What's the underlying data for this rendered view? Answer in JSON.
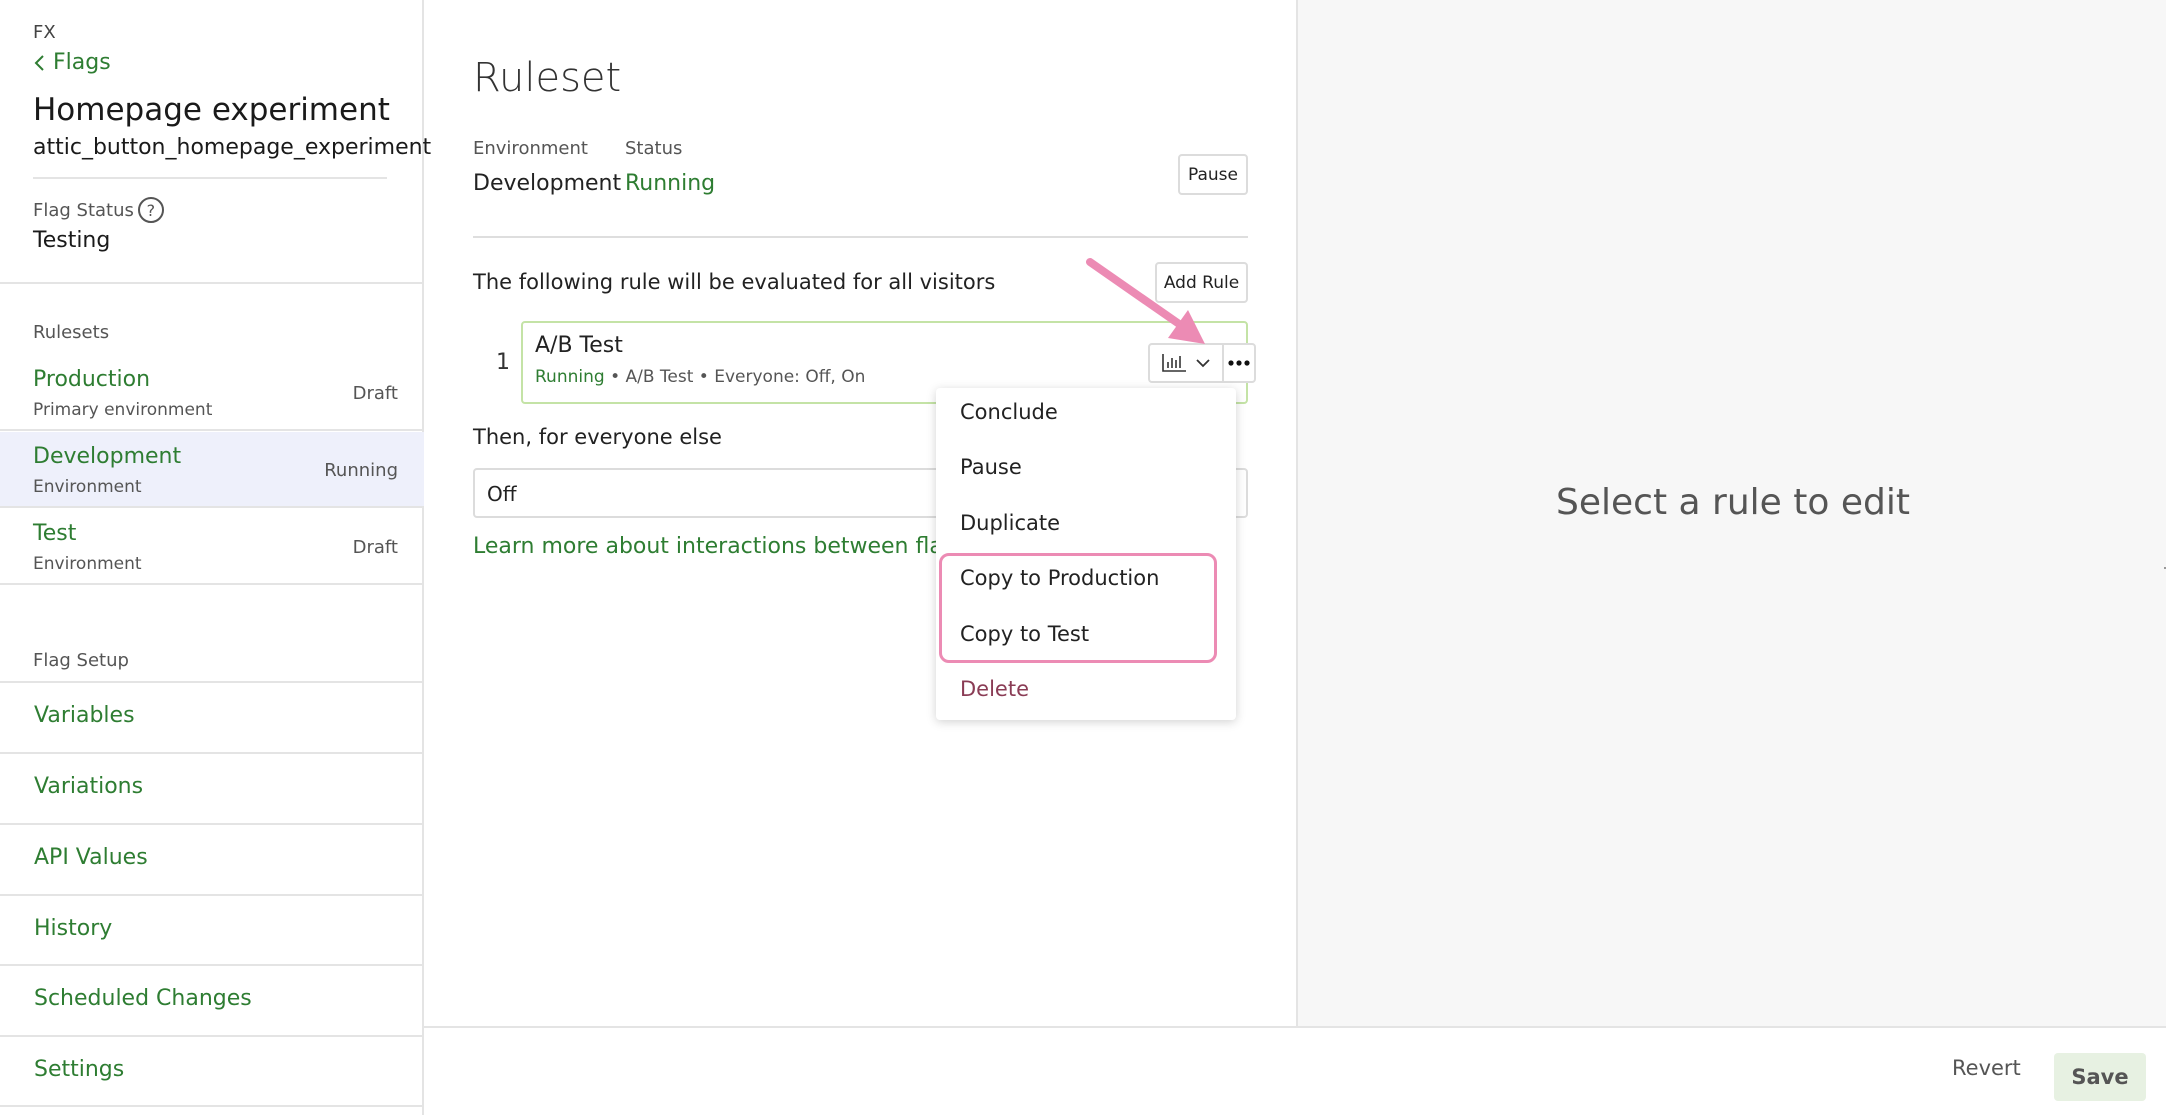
{
  "sidebar": {
    "brand": "FX",
    "back_label": "Flags",
    "flag_title": "Homepage experiment",
    "flag_key": "attic_button_homepage_experiment",
    "flag_status_label": "Flag Status",
    "flag_status_value": "Testing",
    "rulesets_label": "Rulesets",
    "rulesets": [
      {
        "name": "Production",
        "sub": "Primary environment",
        "state": "Draft"
      },
      {
        "name": "Development",
        "sub": "Environment",
        "state": "Running"
      },
      {
        "name": "Test",
        "sub": "Environment",
        "state": "Draft"
      }
    ],
    "setup_label": "Flag Setup",
    "setup_items": [
      "Variables",
      "Variations",
      "API Values",
      "History",
      "Scheduled Changes",
      "Settings"
    ]
  },
  "main": {
    "title": "Ruleset",
    "environment_label": "Environment",
    "environment_value": "Development",
    "status_label": "Status",
    "status_value": "Running",
    "pause_button": "Pause",
    "rule_intro": "The following rule will be evaluated for all visitors",
    "add_rule_button": "Add Rule",
    "rule": {
      "index": "1",
      "name": "A/B Test",
      "status": "Running",
      "details": " • A/B Test • Everyone: Off, On"
    },
    "else_label": "Then, for everyone else",
    "else_value": "Off",
    "learn_link": "Learn more about interactions between flag rul"
  },
  "menu": {
    "items": [
      "Conclude",
      "Pause",
      "Duplicate",
      "Copy to Production",
      "Copy to Test",
      "Delete"
    ]
  },
  "right_panel": {
    "message": "Select a rule to edit"
  },
  "footer": {
    "revert": "Revert",
    "save": "Save"
  },
  "colors": {
    "accent_green": "#2e7d32",
    "active_row_bg": "#eef0fb",
    "highlight_pink": "#ec8bb4",
    "delete_text": "#8a3c55",
    "rule_card_border": "#c4e3a6"
  }
}
